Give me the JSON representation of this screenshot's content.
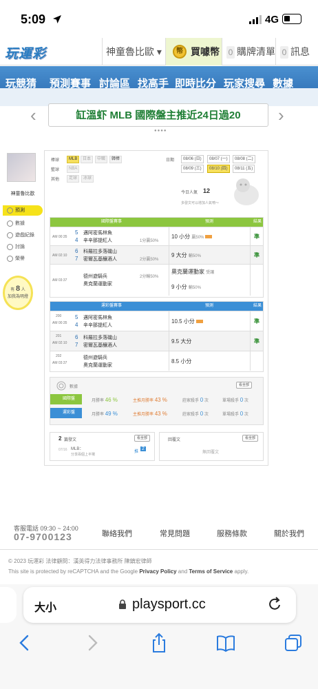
{
  "status_bar": {
    "time": "5:09",
    "network": "4G"
  },
  "header": {
    "logo": "玩運彩",
    "user": "神童魯比歐",
    "buy": "買噱幣",
    "cart": "購牌清單",
    "cart_count": "0",
    "messages": "訊息",
    "msg_count": "0"
  },
  "nav": {
    "items": [
      "玩競猜",
      "預測賽事",
      "討論區",
      "找高手",
      "即時比分",
      "玩家搜尋",
      "數據"
    ]
  },
  "banner": {
    "text": "缸溫虾 MLB 國際盤主推近24日過20"
  },
  "sidebar": {
    "username": "神童魯比歐",
    "items": [
      "預測",
      "數據",
      "遊戲紀錄",
      "討論",
      "榮譽"
    ],
    "fans_prefix": "有",
    "fans_count": "8",
    "fans_unit": "人",
    "fans_suffix": "加我為明燈"
  },
  "filters": {
    "sport_label": "棒球",
    "sports": [
      "MLB",
      "日本",
      "中職",
      "韓棒"
    ],
    "basket_label": "籃球",
    "basket": [
      "NBA"
    ],
    "other_label": "其他",
    "others": [
      "足球",
      "冰球"
    ],
    "date_label": "日期",
    "dates": [
      "08/06 (日)",
      "08/07 (一)",
      "08/08 (二)",
      "08/09 (三)",
      "08/10 (四)",
      "08/11 (五)"
    ],
    "today_label": "今日人氣",
    "today_count": "12",
    "hint": "多發文可以增加人氣唷～"
  },
  "intl": {
    "title": "國際盤賽事",
    "col_pred": "預測",
    "col_result": "結果",
    "rows": [
      {
        "time": "AM 00:35",
        "n1": "5",
        "n2": "4",
        "t1": "邁阿密馬林魚",
        "t2": "辛辛那提紅人",
        "spread": "1分贏50%",
        "pick": "10 小分",
        "pct": "贏50%",
        "res": "準"
      },
      {
        "time": "AM 02:10",
        "n1": "6",
        "n2": "7",
        "t1": "科羅拉多落磯山",
        "t2": "密爾瓦基釀酒人",
        "spread": "2分贏50%",
        "pick": "9 大分",
        "pct": "輸50%",
        "res": "準"
      },
      {
        "time": "AM 03:37",
        "n1": "",
        "n2": "",
        "t1": "德州遊騎兵",
        "t2": "奧克蘭運動家",
        "spread": "2分輸50%",
        "pick": "奧克蘭運動家",
        "pct": "受讓",
        "pick2": "9 小分",
        "pct2": "輸50%",
        "res": ""
      }
    ]
  },
  "lottery": {
    "title": "運彩盤賽事",
    "col_pred": "預測",
    "col_result": "結果",
    "rows": [
      {
        "id": "200",
        "time": "AM 00:35",
        "n1": "5",
        "n2": "4",
        "t1": "邁阿密馬林魚",
        "t2": "辛辛那提紅人",
        "pick": "10.5 小分",
        "res": "準"
      },
      {
        "id": "201",
        "time": "AM 02:10",
        "n1": "6",
        "n2": "7",
        "t1": "科羅拉多落磯山",
        "t2": "密爾瓦基釀酒人",
        "pick": "9.5 大分",
        "res": "準"
      },
      {
        "id": "202",
        "time": "AM 03:37",
        "n1": "",
        "n2": "",
        "t1": "德州遊騎兵",
        "t2": "奧克蘭運動家",
        "pick": "8.5 小分",
        "res": ""
      }
    ]
  },
  "stats": {
    "title": "數據",
    "more": "看全部",
    "rows": [
      {
        "label": "國際盤",
        "month": "月勝率",
        "mv": "46 %",
        "main": "主推月勝率",
        "mainv": "43 %",
        "kill": "莊家殺手",
        "kv": "0",
        "kunit": "次",
        "single": "單場殺手",
        "sv": "0",
        "sunit": "次"
      },
      {
        "label": "運彩盤",
        "month": "月勝率",
        "mv": "49 %",
        "main": "主推月勝率",
        "mainv": "43 %",
        "kill": "莊家殺手",
        "kv": "0",
        "kunit": "次",
        "single": "單場殺手",
        "sv": "0",
        "sunit": "次"
      }
    ]
  },
  "posts": {
    "count": "2",
    "label": "篇發文",
    "more": "看全部",
    "date": "07/16",
    "title": "MLB：",
    "sub": "分享兩個上半場",
    "badge": "推",
    "badge_n": "2",
    "reply_label": "回覆文",
    "reply_more": "看全部",
    "reply_empty": "無回覆文"
  },
  "footer": {
    "service": "客服電話 09:30 ~ 24:00",
    "phone": "07-9700123",
    "links": [
      "聯絡我們",
      "常見問題",
      "服務條款",
      "關於我們"
    ],
    "copy": "© 2023 玩運彩 法律顧問：漢英得力法律事務所 陳鎮宏律師",
    "captcha_pre": "This site is protected by reCAPTCHA and the Google ",
    "privacy": "Privacy Policy",
    "and": " and ",
    "terms": "Terms of Service",
    "apply": " apply."
  },
  "browser": {
    "text_size": "大小",
    "url": "playsport.cc"
  }
}
